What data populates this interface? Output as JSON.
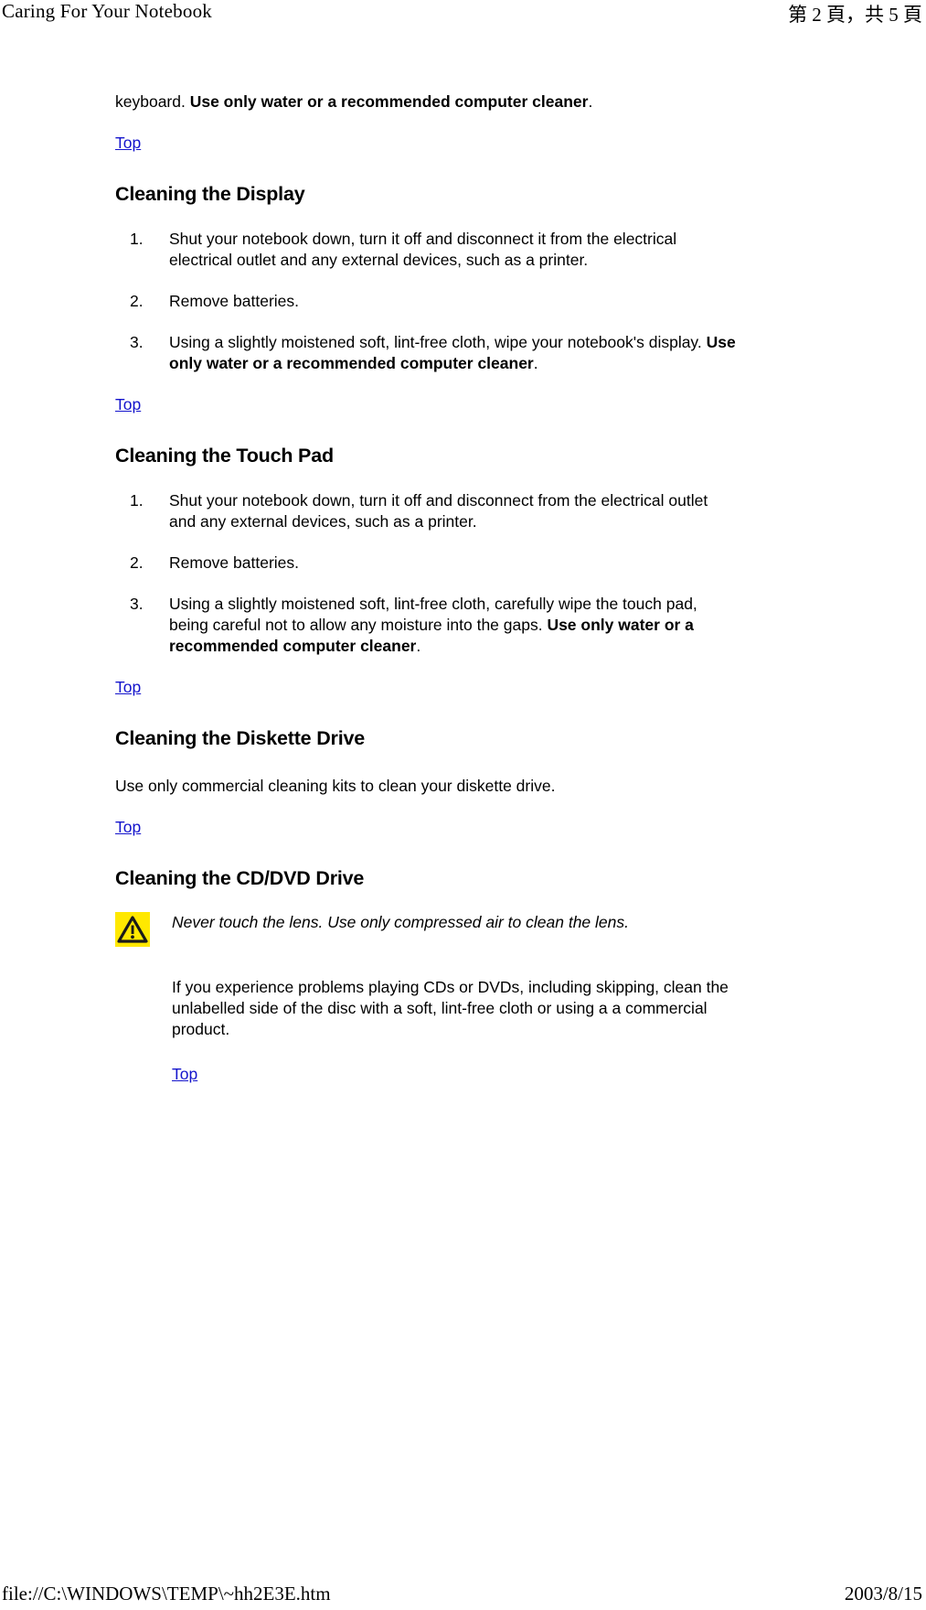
{
  "header": {
    "title": "Caring For Your Notebook",
    "page_indicator": "第 2 頁，共 5 頁"
  },
  "footer": {
    "file_path": "file://C:\\WINDOWS\\TEMP\\~hh2E3E.htm",
    "date": "2003/8/15"
  },
  "top_link_label": "Top",
  "intro": {
    "lead_text": "keyboard. ",
    "bold_text": "Use only water or a recommended computer cleaner",
    "tail_text": "."
  },
  "sections": [
    {
      "heading": "Cleaning the Display",
      "steps": [
        {
          "number": "1.",
          "text": "Shut your notebook down, turn it off and disconnect it from the electrical electrical outlet and any external devices, such as a printer."
        },
        {
          "number": "2.",
          "text": "Remove batteries."
        },
        {
          "number": "3.",
          "pre_text": "Using a slightly moistened soft, lint-free cloth, wipe your notebook's display. ",
          "bold_text": "Use only water or a recommended computer cleaner",
          "post_text": "."
        }
      ]
    },
    {
      "heading": "Cleaning the Touch Pad",
      "steps": [
        {
          "number": "1.",
          "text": "Shut your notebook down, turn it off and disconnect from the electrical outlet and any external devices, such as a printer."
        },
        {
          "number": "2.",
          "text": "Remove batteries."
        },
        {
          "number": "3.",
          "pre_text": "Using a slightly moistened soft, lint-free cloth, carefully wipe the touch pad, being careful not to allow any moisture into the gaps. ",
          "bold_text": "Use only water or a recommended computer cleaner",
          "post_text": "."
        }
      ]
    },
    {
      "heading": "Cleaning the Diskette Drive",
      "paragraph": "Use only commercial cleaning kits to clean your diskette drive."
    },
    {
      "heading": "Cleaning the CD/DVD Drive",
      "warning_icon": "warning-triangle-icon",
      "warning_text": "Never touch the lens. Use only compressed air to clean the lens.",
      "paragraph": "If you experience problems playing CDs or DVDs, including skipping, clean the unlabelled side of the disc with a soft, lint-free cloth or using a a commercial product."
    }
  ],
  "colors": {
    "link": "#1414CC",
    "warning_background": "#FFE800",
    "text": "#000000"
  }
}
